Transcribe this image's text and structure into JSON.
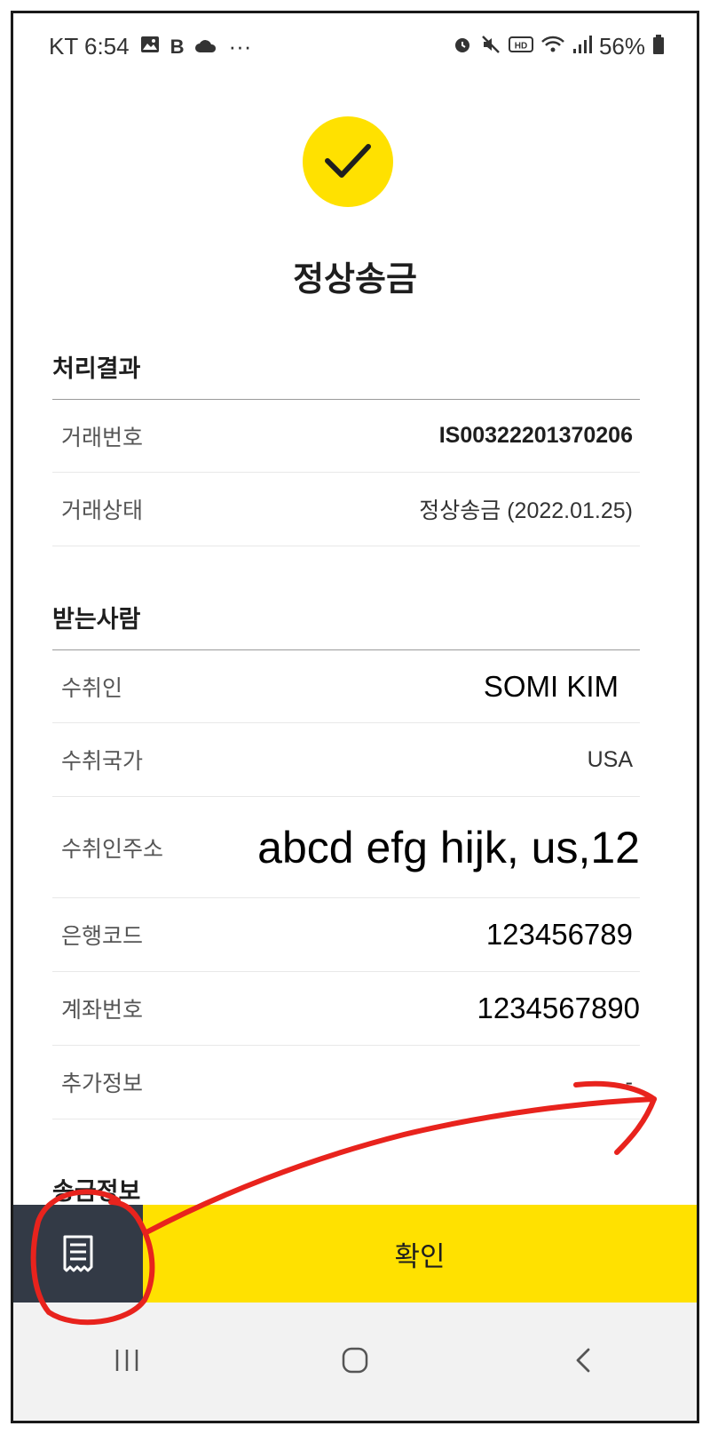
{
  "status_bar": {
    "carrier_time": "KT 6:54",
    "more": "···",
    "battery": "56%"
  },
  "header": {
    "title": "정상송금"
  },
  "processing_result": {
    "section_title": "처리결과",
    "rows": [
      {
        "label": "거래번호",
        "value": "IS00322201370206"
      },
      {
        "label": "거래상태",
        "value": "정상송금 (2022.01.25)"
      }
    ]
  },
  "recipient": {
    "section_title": "받는사람",
    "rows": [
      {
        "label": "수취인",
        "value": "SOMI KIM"
      },
      {
        "label": "수취국가",
        "value": "USA"
      },
      {
        "label": "수취인주소",
        "value": "abcd efg hijk, us,12"
      },
      {
        "label": "은행코드",
        "value": "123456789"
      },
      {
        "label": "계좌번호",
        "value": "1234567890"
      },
      {
        "label": "추가정보",
        "value": "-"
      }
    ]
  },
  "transfer_info": {
    "section_title": "송금정보"
  },
  "bottom": {
    "confirm_label": "확인"
  },
  "icons": {
    "check": "check-icon",
    "receipt": "receipt-icon",
    "nav_recent": "recent-apps-icon",
    "nav_home": "home-icon",
    "nav_back": "back-icon"
  },
  "colors": {
    "accent_yellow": "#ffe100",
    "dark_button": "#333a46",
    "annotation_red": "#e8231d"
  }
}
